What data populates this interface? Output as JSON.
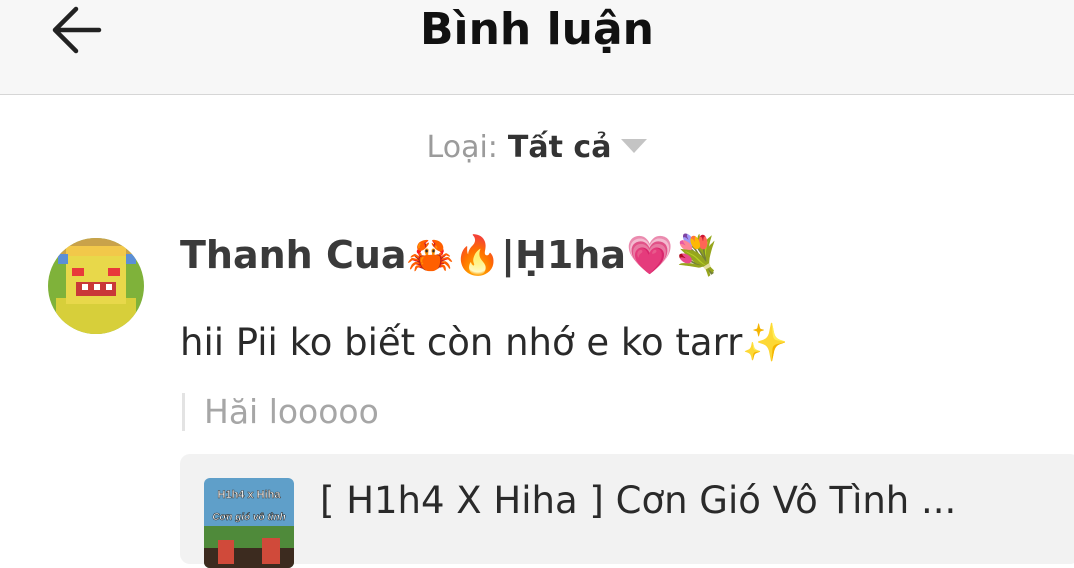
{
  "header": {
    "title": "Bình luận",
    "back_icon": "arrow-left-icon"
  },
  "filter": {
    "label": "Loại:",
    "value": "Tất cả",
    "icon": "caret-down-icon"
  },
  "comment": {
    "author": "Thanh Cua🦀🔥|Ḥ1ha💗💐",
    "text": "hii Pii ko biết còn nhớ e ko tarr✨",
    "reply_preview": "Hăi looooo",
    "video": {
      "title": "[ H1h4 X Hiha ] Cơn Gió Vô Tình ...",
      "thumbnail_text_top": "H1h4 x Hiha",
      "thumbnail_text_bottom": "Cơn gió vô tình"
    }
  }
}
